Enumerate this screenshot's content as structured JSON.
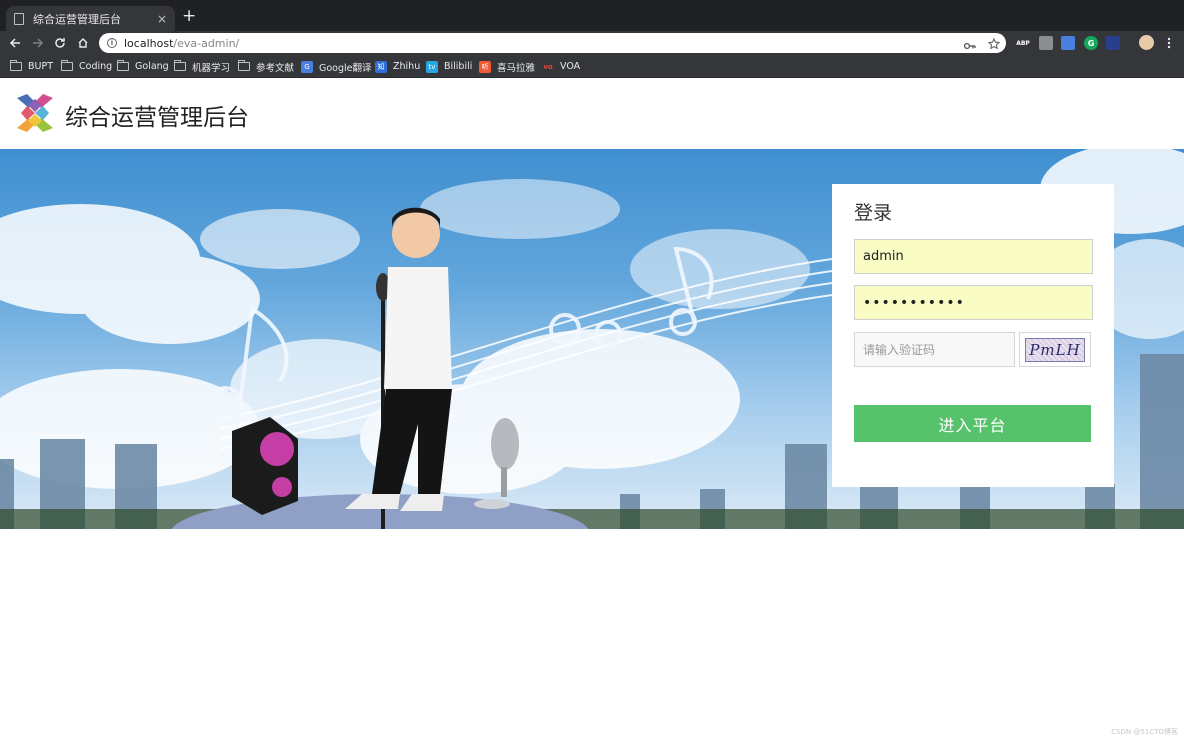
{
  "browser": {
    "tab_title": "综合运营管理后台",
    "tab_close": "×",
    "new_tab": "+",
    "url_host": "localhost",
    "url_path": "/eva-admin/",
    "bookmarks": [
      {
        "label": "BUPT",
        "kind": "folder"
      },
      {
        "label": "Coding",
        "kind": "folder"
      },
      {
        "label": "Golang",
        "kind": "folder"
      },
      {
        "label": "机器学习",
        "kind": "folder"
      },
      {
        "label": "参考文献",
        "kind": "folder"
      },
      {
        "label": "Google翻译",
        "kind": "site",
        "icon": "google-translate-icon",
        "color": "#4a7fe0"
      },
      {
        "label": "Zhihu",
        "kind": "site",
        "icon": "zhihu-icon",
        "color": "#2f6fd8"
      },
      {
        "label": "Bilibili",
        "kind": "site",
        "icon": "bilibili-icon",
        "color": "#26a5e0"
      },
      {
        "label": "喜马拉雅",
        "kind": "site",
        "icon": "ximalaya-icon",
        "color": "#f15a33"
      },
      {
        "label": "VOA",
        "kind": "site",
        "icon": "voa-icon",
        "color": "#e04b3c"
      }
    ],
    "extensions": [
      {
        "name": "adblock-plus-icon",
        "text": "ABP",
        "color": "#d63b2f"
      },
      {
        "name": "reader-icon",
        "text": "",
        "color": "#8a8d91"
      },
      {
        "name": "translate-icon",
        "text": "",
        "color": "#4a7fe0"
      },
      {
        "name": "grammarly-icon",
        "text": "G",
        "color": "#15a85c"
      },
      {
        "name": "extension-icon",
        "text": "",
        "color": "#2a3e8f"
      }
    ]
  },
  "header": {
    "site_title": "综合运营管理后台"
  },
  "login": {
    "title": "登录",
    "username_value": "admin",
    "password_value": "•••••••••••",
    "captcha_placeholder": "请输入验证码",
    "captcha_code": "PmLH",
    "submit_label": "进入平台"
  },
  "footer": {
    "watermark": "CSDN @51CTO博客"
  },
  "colors": {
    "primary_button": "#56c26b",
    "autofill_bg": "#fafcc6"
  }
}
